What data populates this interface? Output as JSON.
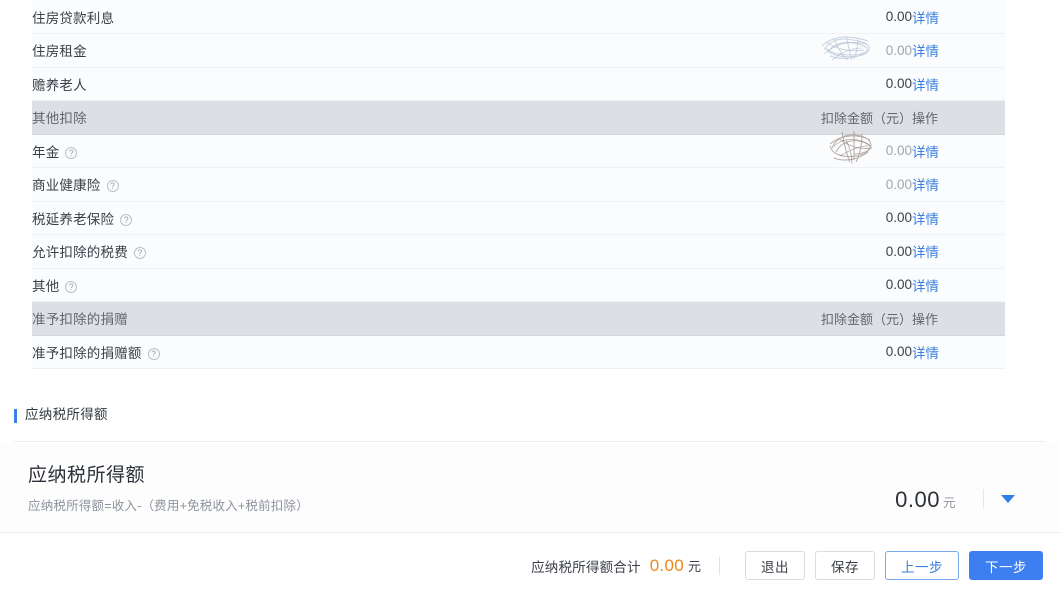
{
  "table": {
    "rows": [
      {
        "type": "data",
        "label": "住房贷款利息",
        "help": false,
        "amount": "0.00",
        "action": "详情",
        "obscured": false,
        "faded": false
      },
      {
        "type": "data",
        "label": "住房租金",
        "help": false,
        "amount": "0.00",
        "action": "详情",
        "obscured": true,
        "faded": true
      },
      {
        "type": "data",
        "label": "赡养老人",
        "help": false,
        "amount": "0.00",
        "action": "详情",
        "obscured": false,
        "faded": false
      },
      {
        "type": "group",
        "label": "其他扣除",
        "help": false,
        "amount": "扣除金额（元）",
        "action": "操作",
        "obscured": false,
        "faded": false
      },
      {
        "type": "data",
        "label": "年金",
        "help": true,
        "amount": "0.00",
        "action": "详情",
        "obscured": true,
        "faded": true
      },
      {
        "type": "data",
        "label": "商业健康险",
        "help": true,
        "amount": "0.00",
        "action": "详情",
        "obscured": false,
        "faded": true
      },
      {
        "type": "data",
        "label": "税延养老保险",
        "help": true,
        "amount": "0.00",
        "action": "详情",
        "obscured": false,
        "faded": false
      },
      {
        "type": "data",
        "label": "允许扣除的税费",
        "help": true,
        "amount": "0.00",
        "action": "详情",
        "obscured": false,
        "faded": false
      },
      {
        "type": "data",
        "label": "其他",
        "help": true,
        "amount": "0.00",
        "action": "详情",
        "obscured": false,
        "faded": false
      },
      {
        "type": "group",
        "label": "准予扣除的捐赠",
        "help": false,
        "amount": "扣除金额（元）",
        "action": "操作",
        "obscured": false,
        "faded": false
      },
      {
        "type": "data",
        "label": "准予扣除的捐赠额",
        "help": true,
        "amount": "0.00",
        "action": "详情",
        "obscured": false,
        "faded": false
      }
    ]
  },
  "section": {
    "title": "应纳税所得额"
  },
  "summary": {
    "title": "应纳税所得额",
    "formula": "应纳税所得额=收入-（费用+免税收入+税前扣除）",
    "amount": "0.00",
    "unit": "元",
    "caret_icon": "chevron-down-icon"
  },
  "footer": {
    "total_label": "应纳税所得额合计",
    "total_value": "0.00",
    "total_unit": "元",
    "exit_label": "退出",
    "save_label": "保存",
    "prev_label": "上一步",
    "next_label": "下一步"
  },
  "colors": {
    "accent_blue": "#3d7ff0",
    "link_blue": "#3a7fe0",
    "total_orange": "#f08519",
    "group_row_bg": "#dcdfe3",
    "data_row_bg": "#fbfcfd"
  }
}
